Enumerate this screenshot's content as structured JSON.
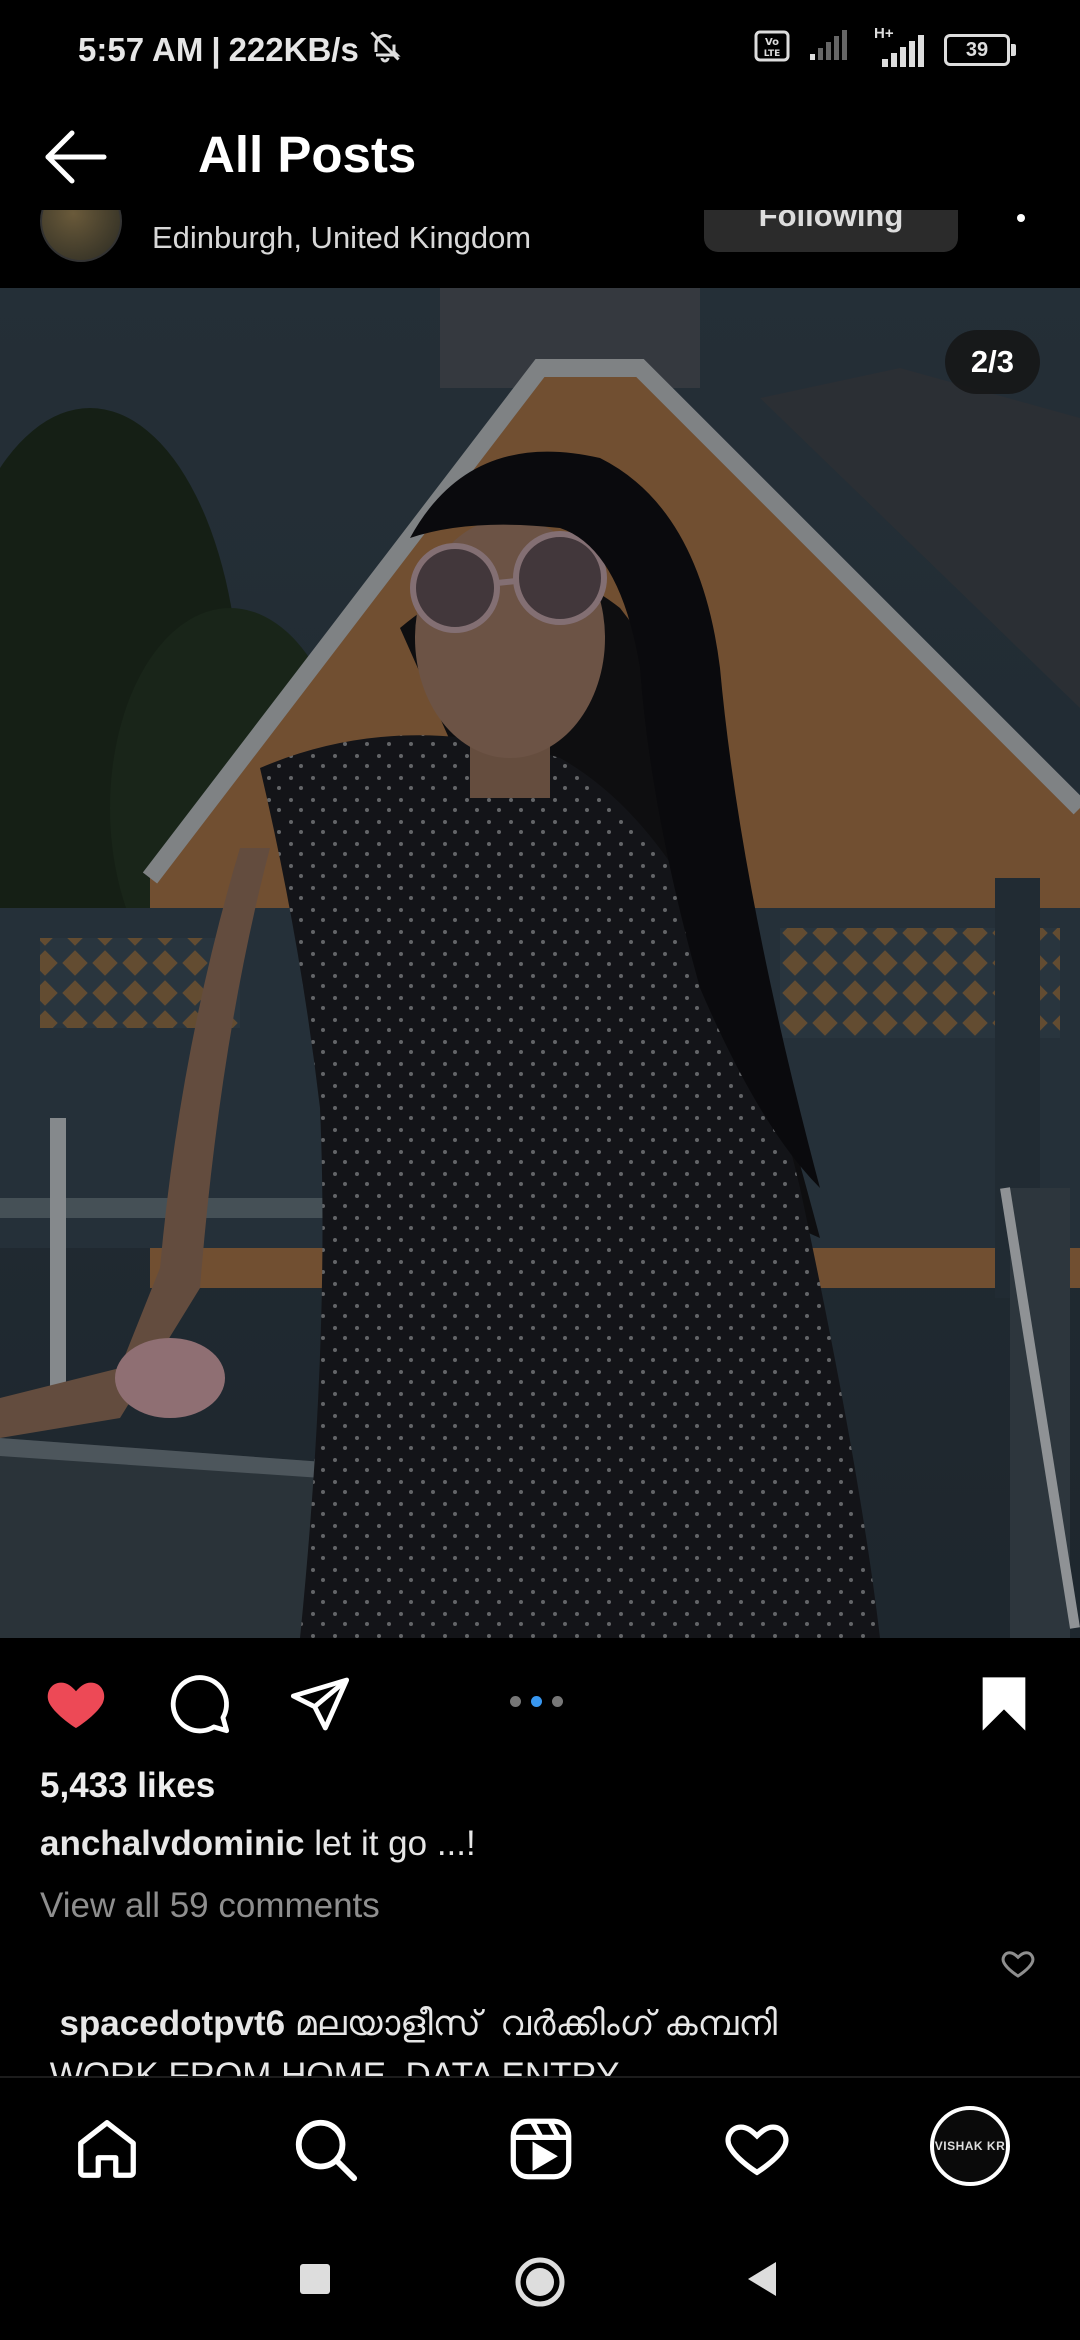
{
  "status_bar": {
    "time": "5:57 AM",
    "separator": "|",
    "speed": "222KB/s",
    "network_label": "H+",
    "battery": "39"
  },
  "header": {
    "title": "All Posts"
  },
  "post": {
    "location": "Edinburgh, United Kingdom",
    "follow_label": "Following",
    "page_indicator": "2/3",
    "carousel_total": 3,
    "carousel_active": 2,
    "likes": "5,433 likes",
    "caption_user": "anchalvdominic",
    "caption_text": " let it go ...!",
    "view_comments": "View all 59 comments",
    "comment_user": "spacedotpvt6",
    "comment_text": " മലയാളീസ്  വർക്കിംഗ് കമ്പനി\n WORK FROM HOME  DATA ENTRY\n AND  CAPTCHA !!😊😊😊😊"
  },
  "bottom_nav": {
    "profile_label": "VISHAK KR"
  },
  "colors": {
    "background": "#000000",
    "like_active": "#ed4956",
    "carousel_active_dot": "#3897f0"
  }
}
